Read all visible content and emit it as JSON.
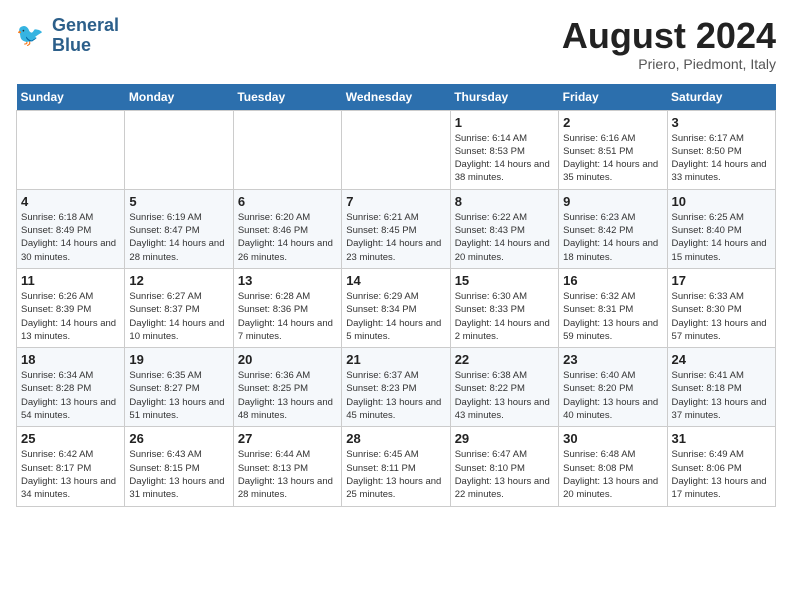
{
  "logo": {
    "line1": "General",
    "line2": "Blue"
  },
  "title": "August 2024",
  "subtitle": "Priero, Piedmont, Italy",
  "days_of_week": [
    "Sunday",
    "Monday",
    "Tuesday",
    "Wednesday",
    "Thursday",
    "Friday",
    "Saturday"
  ],
  "weeks": [
    [
      {
        "day": "",
        "sunrise": "",
        "sunset": "",
        "daylight": ""
      },
      {
        "day": "",
        "sunrise": "",
        "sunset": "",
        "daylight": ""
      },
      {
        "day": "",
        "sunrise": "",
        "sunset": "",
        "daylight": ""
      },
      {
        "day": "",
        "sunrise": "",
        "sunset": "",
        "daylight": ""
      },
      {
        "day": "1",
        "sunrise": "6:14 AM",
        "sunset": "8:53 PM",
        "daylight": "14 hours and 38 minutes."
      },
      {
        "day": "2",
        "sunrise": "6:16 AM",
        "sunset": "8:51 PM",
        "daylight": "14 hours and 35 minutes."
      },
      {
        "day": "3",
        "sunrise": "6:17 AM",
        "sunset": "8:50 PM",
        "daylight": "14 hours and 33 minutes."
      }
    ],
    [
      {
        "day": "4",
        "sunrise": "6:18 AM",
        "sunset": "8:49 PM",
        "daylight": "14 hours and 30 minutes."
      },
      {
        "day": "5",
        "sunrise": "6:19 AM",
        "sunset": "8:47 PM",
        "daylight": "14 hours and 28 minutes."
      },
      {
        "day": "6",
        "sunrise": "6:20 AM",
        "sunset": "8:46 PM",
        "daylight": "14 hours and 26 minutes."
      },
      {
        "day": "7",
        "sunrise": "6:21 AM",
        "sunset": "8:45 PM",
        "daylight": "14 hours and 23 minutes."
      },
      {
        "day": "8",
        "sunrise": "6:22 AM",
        "sunset": "8:43 PM",
        "daylight": "14 hours and 20 minutes."
      },
      {
        "day": "9",
        "sunrise": "6:23 AM",
        "sunset": "8:42 PM",
        "daylight": "14 hours and 18 minutes."
      },
      {
        "day": "10",
        "sunrise": "6:25 AM",
        "sunset": "8:40 PM",
        "daylight": "14 hours and 15 minutes."
      }
    ],
    [
      {
        "day": "11",
        "sunrise": "6:26 AM",
        "sunset": "8:39 PM",
        "daylight": "14 hours and 13 minutes."
      },
      {
        "day": "12",
        "sunrise": "6:27 AM",
        "sunset": "8:37 PM",
        "daylight": "14 hours and 10 minutes."
      },
      {
        "day": "13",
        "sunrise": "6:28 AM",
        "sunset": "8:36 PM",
        "daylight": "14 hours and 7 minutes."
      },
      {
        "day": "14",
        "sunrise": "6:29 AM",
        "sunset": "8:34 PM",
        "daylight": "14 hours and 5 minutes."
      },
      {
        "day": "15",
        "sunrise": "6:30 AM",
        "sunset": "8:33 PM",
        "daylight": "14 hours and 2 minutes."
      },
      {
        "day": "16",
        "sunrise": "6:32 AM",
        "sunset": "8:31 PM",
        "daylight": "13 hours and 59 minutes."
      },
      {
        "day": "17",
        "sunrise": "6:33 AM",
        "sunset": "8:30 PM",
        "daylight": "13 hours and 57 minutes."
      }
    ],
    [
      {
        "day": "18",
        "sunrise": "6:34 AM",
        "sunset": "8:28 PM",
        "daylight": "13 hours and 54 minutes."
      },
      {
        "day": "19",
        "sunrise": "6:35 AM",
        "sunset": "8:27 PM",
        "daylight": "13 hours and 51 minutes."
      },
      {
        "day": "20",
        "sunrise": "6:36 AM",
        "sunset": "8:25 PM",
        "daylight": "13 hours and 48 minutes."
      },
      {
        "day": "21",
        "sunrise": "6:37 AM",
        "sunset": "8:23 PM",
        "daylight": "13 hours and 45 minutes."
      },
      {
        "day": "22",
        "sunrise": "6:38 AM",
        "sunset": "8:22 PM",
        "daylight": "13 hours and 43 minutes."
      },
      {
        "day": "23",
        "sunrise": "6:40 AM",
        "sunset": "8:20 PM",
        "daylight": "13 hours and 40 minutes."
      },
      {
        "day": "24",
        "sunrise": "6:41 AM",
        "sunset": "8:18 PM",
        "daylight": "13 hours and 37 minutes."
      }
    ],
    [
      {
        "day": "25",
        "sunrise": "6:42 AM",
        "sunset": "8:17 PM",
        "daylight": "13 hours and 34 minutes."
      },
      {
        "day": "26",
        "sunrise": "6:43 AM",
        "sunset": "8:15 PM",
        "daylight": "13 hours and 31 minutes."
      },
      {
        "day": "27",
        "sunrise": "6:44 AM",
        "sunset": "8:13 PM",
        "daylight": "13 hours and 28 minutes."
      },
      {
        "day": "28",
        "sunrise": "6:45 AM",
        "sunset": "8:11 PM",
        "daylight": "13 hours and 25 minutes."
      },
      {
        "day": "29",
        "sunrise": "6:47 AM",
        "sunset": "8:10 PM",
        "daylight": "13 hours and 22 minutes."
      },
      {
        "day": "30",
        "sunrise": "6:48 AM",
        "sunset": "8:08 PM",
        "daylight": "13 hours and 20 minutes."
      },
      {
        "day": "31",
        "sunrise": "6:49 AM",
        "sunset": "8:06 PM",
        "daylight": "13 hours and 17 minutes."
      }
    ]
  ]
}
